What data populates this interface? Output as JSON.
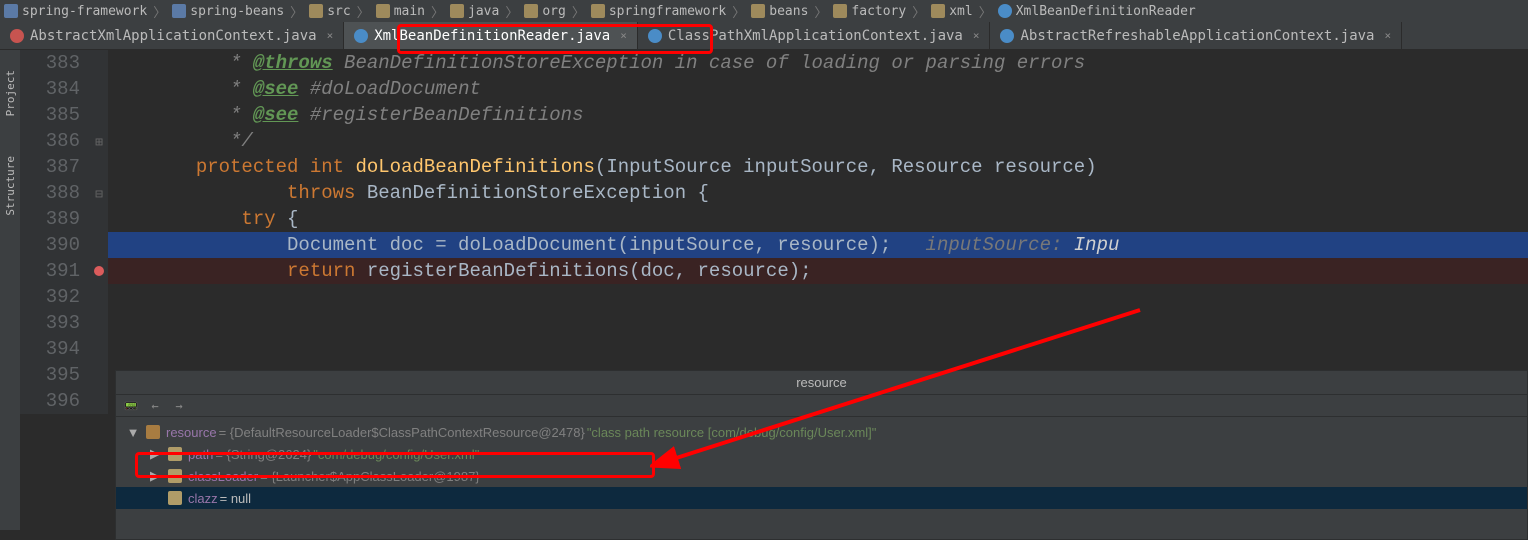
{
  "breadcrumbs": [
    {
      "icon": "module",
      "label": "spring-framework"
    },
    {
      "icon": "module",
      "label": "spring-beans"
    },
    {
      "icon": "folder",
      "label": "src"
    },
    {
      "icon": "folder",
      "label": "main"
    },
    {
      "icon": "folder",
      "label": "java"
    },
    {
      "icon": "folder",
      "label": "org"
    },
    {
      "icon": "folder",
      "label": "springframework"
    },
    {
      "icon": "folder",
      "label": "beans"
    },
    {
      "icon": "folder",
      "label": "factory"
    },
    {
      "icon": "folder",
      "label": "xml"
    },
    {
      "icon": "jclass",
      "label": "XmlBeanDefinitionReader"
    }
  ],
  "tabs": [
    {
      "icon": "red",
      "label": "AbstractXmlApplicationContext.java",
      "active": false
    },
    {
      "icon": "blue",
      "label": "XmlBeanDefinitionReader.java",
      "active": true
    },
    {
      "icon": "blue",
      "label": "ClassPathXmlApplicationContext.java",
      "active": false
    },
    {
      "icon": "blue",
      "label": "AbstractRefreshableApplicationContext.java",
      "active": false
    }
  ],
  "sidebar_left": [
    "Project",
    "Structure"
  ],
  "code_lines": [
    {
      "n": 383,
      "type": "comment",
      "segments": [
        {
          "cls": "c-comment",
          "t": "          * "
        },
        {
          "cls": "c-tag",
          "t": "@throws"
        },
        {
          "cls": "c-comment",
          "t": " BeanDefinitionStoreException in case of loading or parsing errors"
        }
      ]
    },
    {
      "n": 384,
      "type": "comment",
      "segments": [
        {
          "cls": "c-comment",
          "t": "          * "
        },
        {
          "cls": "c-tag",
          "t": "@see"
        },
        {
          "cls": "c-link",
          "t": " #doLoadDocument"
        }
      ]
    },
    {
      "n": 385,
      "type": "comment",
      "segments": [
        {
          "cls": "c-comment",
          "t": "          * "
        },
        {
          "cls": "c-tag",
          "t": "@see"
        },
        {
          "cls": "c-link",
          "t": " #registerBeanDefinitions"
        }
      ]
    },
    {
      "n": 386,
      "type": "comment",
      "segments": [
        {
          "cls": "c-comment",
          "t": "          */"
        }
      ],
      "fold": "close"
    },
    {
      "n": 387,
      "type": "code",
      "segments": [
        {
          "cls": "c-ident",
          "t": "       "
        },
        {
          "cls": "c-keyword",
          "t": "protected int "
        },
        {
          "cls": "c-method",
          "t": "doLoadBeanDefinitions"
        },
        {
          "cls": "c-ident",
          "t": "(InputSource inputSource, Resource resource)"
        }
      ]
    },
    {
      "n": 388,
      "type": "code",
      "segments": [
        {
          "cls": "c-ident",
          "t": "               "
        },
        {
          "cls": "c-keyword",
          "t": "throws "
        },
        {
          "cls": "c-ident",
          "t": "BeanDefinitionStoreException {"
        }
      ],
      "fold": "open"
    },
    {
      "n": 389,
      "type": "code",
      "segments": [
        {
          "cls": "c-ident",
          "t": "           "
        },
        {
          "cls": "c-keyword",
          "t": "try "
        },
        {
          "cls": "c-ident",
          "t": "{"
        }
      ]
    },
    {
      "n": 390,
      "type": "hi",
      "segments": [
        {
          "cls": "c-ident",
          "t": "               Document doc = doLoadDocument(inputSource, resource);   "
        },
        {
          "cls": "c-hintlbl",
          "t": "inputSource: "
        },
        {
          "cls": "c-hintval",
          "t": "Inpu"
        }
      ]
    },
    {
      "n": 391,
      "type": "bp",
      "segments": [
        {
          "cls": "c-ident",
          "t": "               "
        },
        {
          "cls": "c-keyword",
          "t": "return "
        },
        {
          "cls": "c-ident",
          "t": "registerBeanDefinitions(doc, resource);"
        }
      ]
    },
    {
      "n": 392,
      "type": "code",
      "segments": []
    },
    {
      "n": 393,
      "type": "code",
      "segments": []
    },
    {
      "n": 394,
      "type": "code",
      "segments": []
    },
    {
      "n": 395,
      "type": "code",
      "segments": []
    },
    {
      "n": 396,
      "type": "code",
      "segments": []
    }
  ],
  "debugger": {
    "title": "resource",
    "toolbar": [
      "calc",
      "back",
      "forward"
    ],
    "vars": [
      {
        "indent": 1,
        "expand": "▼",
        "icon": "obj",
        "name": "resource",
        "dim": " = {DefaultResourceLoader$ClassPathContextResource@2478} ",
        "str": "\"class path resource [com/debug/config/User.xml]\"",
        "sel": false
      },
      {
        "indent": 2,
        "expand": "▶",
        "icon": "field",
        "name": "path",
        "dim": " = {String@2624} ",
        "str": "\"com/debug/config/User.xml\"",
        "sel": false
      },
      {
        "indent": 2,
        "expand": "▶",
        "icon": "field",
        "name": "classLoader",
        "dim": " = {Launcher$AppClassLoader@1987}",
        "str": "",
        "sel": false
      },
      {
        "indent": 2,
        "expand": "",
        "icon": "field",
        "name": "clazz",
        "text": " = null",
        "sel": true
      }
    ]
  }
}
